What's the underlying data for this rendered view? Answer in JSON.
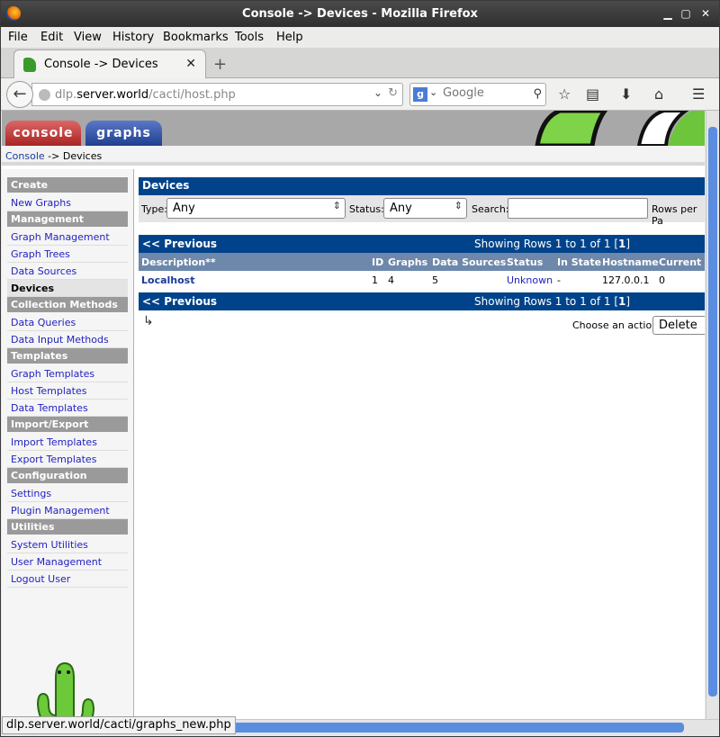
{
  "window": {
    "title": "Console -> Devices - Mozilla Firefox"
  },
  "menu": [
    "File",
    "Edit",
    "View",
    "History",
    "Bookmarks",
    "Tools",
    "Help"
  ],
  "tab": {
    "label": "Console -> Devices"
  },
  "url": {
    "host_prefix": "dlp.",
    "host": "server.world",
    "path": "/cacti/host.php"
  },
  "search": {
    "placeholder": "Google"
  },
  "banner": {
    "console_tab": "console",
    "graphs_tab": "graphs"
  },
  "breadcrumb": {
    "root": "Console",
    "separator": "->",
    "current": "Devices"
  },
  "sidebar": [
    {
      "type": "head",
      "label": "Create"
    },
    {
      "type": "item",
      "label": "New Graphs"
    },
    {
      "type": "head",
      "label": "Management"
    },
    {
      "type": "item",
      "label": "Graph Management"
    },
    {
      "type": "item",
      "label": "Graph Trees"
    },
    {
      "type": "item",
      "label": "Data Sources"
    },
    {
      "type": "item",
      "label": "Devices",
      "selected": true
    },
    {
      "type": "head",
      "label": "Collection Methods"
    },
    {
      "type": "item",
      "label": "Data Queries"
    },
    {
      "type": "item",
      "label": "Data Input Methods"
    },
    {
      "type": "head",
      "label": "Templates"
    },
    {
      "type": "item",
      "label": "Graph Templates"
    },
    {
      "type": "item",
      "label": "Host Templates"
    },
    {
      "type": "item",
      "label": "Data Templates"
    },
    {
      "type": "head",
      "label": "Import/Export"
    },
    {
      "type": "item",
      "label": "Import Templates"
    },
    {
      "type": "item",
      "label": "Export Templates"
    },
    {
      "type": "head",
      "label": "Configuration"
    },
    {
      "type": "item",
      "label": "Settings"
    },
    {
      "type": "item",
      "label": "Plugin Management"
    },
    {
      "type": "head",
      "label": "Utilities"
    },
    {
      "type": "item",
      "label": "System Utilities"
    },
    {
      "type": "item",
      "label": "User Management"
    },
    {
      "type": "item",
      "label": "Logout User"
    }
  ],
  "devices": {
    "title": "Devices",
    "filter": {
      "type_label": "Type:",
      "type_value": "Any",
      "status_label": "Status:",
      "status_value": "Any",
      "search_label": "Search:",
      "search_value": "",
      "rows_label": "Rows per Pa"
    },
    "nav": {
      "prev": "<< Previous",
      "showing_prefix": "Showing Rows 1 to 1 of 1 [",
      "page": "1",
      "showing_suffix": "]"
    },
    "columns": [
      "Description**",
      "ID",
      "Graphs",
      "Data Sources",
      "Status",
      "In State",
      "Hostname",
      "Current (m"
    ],
    "rows": [
      {
        "description": "Localhost",
        "id": "1",
        "graphs": "4",
        "data_sources": "5",
        "status": "Unknown",
        "in_state": "-",
        "hostname": "127.0.0.1",
        "current": "0"
      }
    ],
    "action_label": "Choose an action:",
    "action_value": "Delete"
  },
  "status_bar": {
    "text": "dlp.server.world/cacti/graphs_new.php"
  }
}
